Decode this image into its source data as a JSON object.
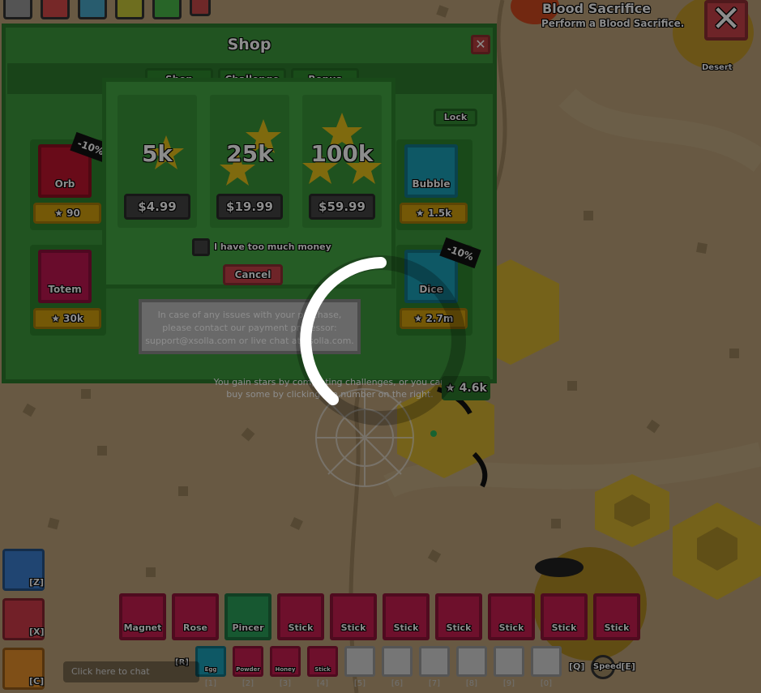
{
  "quest": {
    "title": "Blood Sacrifice",
    "subtitle": "Perform a Blood Sacrifice."
  },
  "zone": {
    "label": "Desert"
  },
  "shop": {
    "title": "Shop",
    "tabs": [
      "Shop",
      "Challenge",
      "Bonus"
    ],
    "lock_label": "Lock",
    "items": [
      {
        "name": "Orb",
        "price": "90",
        "color": "#c0142e"
      },
      {
        "name": "Bubble",
        "price": "1.5k",
        "color": "#1aa0b8"
      },
      {
        "name": "Totem",
        "price": "30k",
        "color": "#c01650"
      },
      {
        "name": "Dice",
        "price": "2.7m",
        "color": "#1aa0b8"
      }
    ],
    "discounts": [
      "-10%",
      "-10%"
    ],
    "balance": "4.6k",
    "note_line1": "You gain stars by completing challenges, or you can",
    "note_line2": "buy some by clicking the number on the right."
  },
  "purchase": {
    "packs": [
      {
        "amount": "5k",
        "cost": "$4.99"
      },
      {
        "amount": "25k",
        "cost": "$19.99"
      },
      {
        "amount": "100k",
        "cost": "$59.99"
      }
    ],
    "checkbox_label": "I have too much money",
    "cancel_label": "Cancel"
  },
  "support_text": {
    "line1": "In case of any issues with your purchase,",
    "line2": "please contact our payment processor:",
    "line3": "support@xsolla.com or live chat at xsolla.com."
  },
  "hotbar": [
    {
      "name": "Magnet",
      "color": "#c81e50"
    },
    {
      "name": "Rose",
      "color": "#c81e50"
    },
    {
      "name": "Pincer",
      "color": "#2ba05a"
    },
    {
      "name": "Stick",
      "color": "#c81e50"
    },
    {
      "name": "Stick",
      "color": "#c81e50"
    },
    {
      "name": "Stick",
      "color": "#c81e50"
    },
    {
      "name": "Stick",
      "color": "#c81e50"
    },
    {
      "name": "Stick",
      "color": "#c81e50"
    },
    {
      "name": "Stick",
      "color": "#c81e50"
    },
    {
      "name": "Stick",
      "color": "#c81e50"
    }
  ],
  "secondary": [
    {
      "name": "Egg",
      "key": "[1]",
      "color": "#1aa0b8"
    },
    {
      "name": "Powder",
      "key": "[2]",
      "color": "#c81e50"
    },
    {
      "name": "Honey",
      "key": "[3]",
      "color": "#c81e50"
    },
    {
      "name": "Stick",
      "key": "[4]",
      "color": "#c81e50"
    },
    {
      "name": "",
      "key": "[5]",
      "color": "#d8d8d8"
    },
    {
      "name": "",
      "key": "[6]",
      "color": "#d8d8d8"
    },
    {
      "name": "",
      "key": "[7]",
      "color": "#d8d8d8"
    },
    {
      "name": "",
      "key": "[8]",
      "color": "#d8d8d8"
    },
    {
      "name": "",
      "key": "[9]",
      "color": "#d8d8d8"
    },
    {
      "name": "",
      "key": "[0]",
      "color": "#d8d8d8"
    }
  ],
  "row_key_label": "[R]",
  "side_buttons": [
    {
      "key": "[Z]",
      "color": "#3b7fd0"
    },
    {
      "key": "[X]",
      "color": "#d03b4a"
    },
    {
      "key": "[C]",
      "color": "#e8902a"
    }
  ],
  "chat_placeholder": "Click here to chat",
  "speed": {
    "q": "[Q]",
    "label": "Speed",
    "e": "[E]"
  }
}
